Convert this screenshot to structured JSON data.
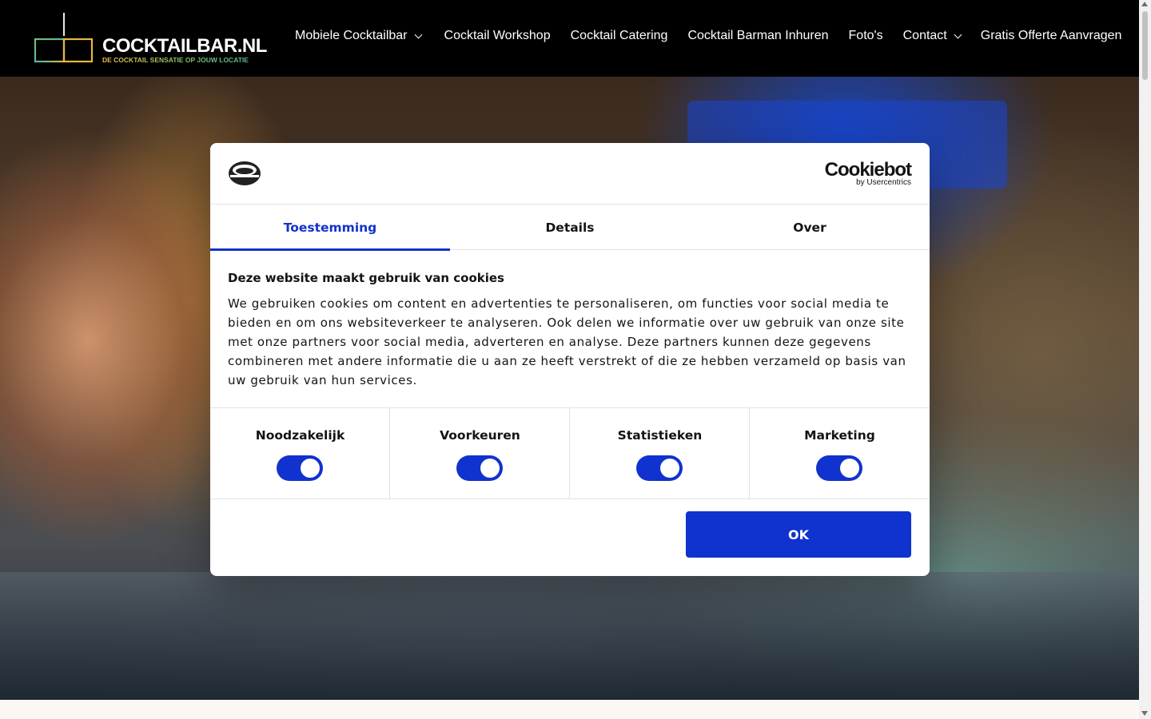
{
  "header": {
    "logo_text": "COCKTAILBAR.NL",
    "logo_tagline": "DE COCKTAIL SENSATIE OP JOUW LOCATIE",
    "nav": [
      {
        "label": "Mobiele Cocktailbar",
        "has_dropdown": true
      },
      {
        "label": "Cocktail Workshop",
        "has_dropdown": false
      },
      {
        "label": "Cocktail Catering",
        "has_dropdown": false
      },
      {
        "label": "Cocktail Barman Inhuren",
        "has_dropdown": false
      },
      {
        "label": "Foto's",
        "has_dropdown": false
      },
      {
        "label": "Contact",
        "has_dropdown": true
      },
      {
        "label": "Gratis Offerte Aanvragen",
        "has_dropdown": false
      }
    ]
  },
  "cookie_dialog": {
    "provider_name": "Cookiebot",
    "provider_sub": "by Usercentrics",
    "tabs": [
      {
        "label": "Toestemming",
        "active": true
      },
      {
        "label": "Details",
        "active": false
      },
      {
        "label": "Over",
        "active": false
      }
    ],
    "title": "Deze website maakt gebruik van cookies",
    "text": "We gebruiken cookies om content en advertenties te personaliseren, om functies voor social media te bieden en om ons websiteverkeer te analyseren. Ook delen we informatie over uw gebruik van onze site met onze partners voor social media, adverteren en analyse. Deze partners kunnen deze gegevens combineren met andere informatie die u aan ze heeft verstrekt of die ze hebben verzameld op basis van uw gebruik van hun services.",
    "levels": [
      {
        "label": "Noodzakelijk",
        "enabled": true
      },
      {
        "label": "Voorkeuren",
        "enabled": true
      },
      {
        "label": "Statistieken",
        "enabled": true
      },
      {
        "label": "Marketing",
        "enabled": true
      }
    ],
    "ok_label": "OK"
  },
  "colors": {
    "accent": "#1032cf",
    "header_bg": "#000000",
    "text": "#141414"
  }
}
